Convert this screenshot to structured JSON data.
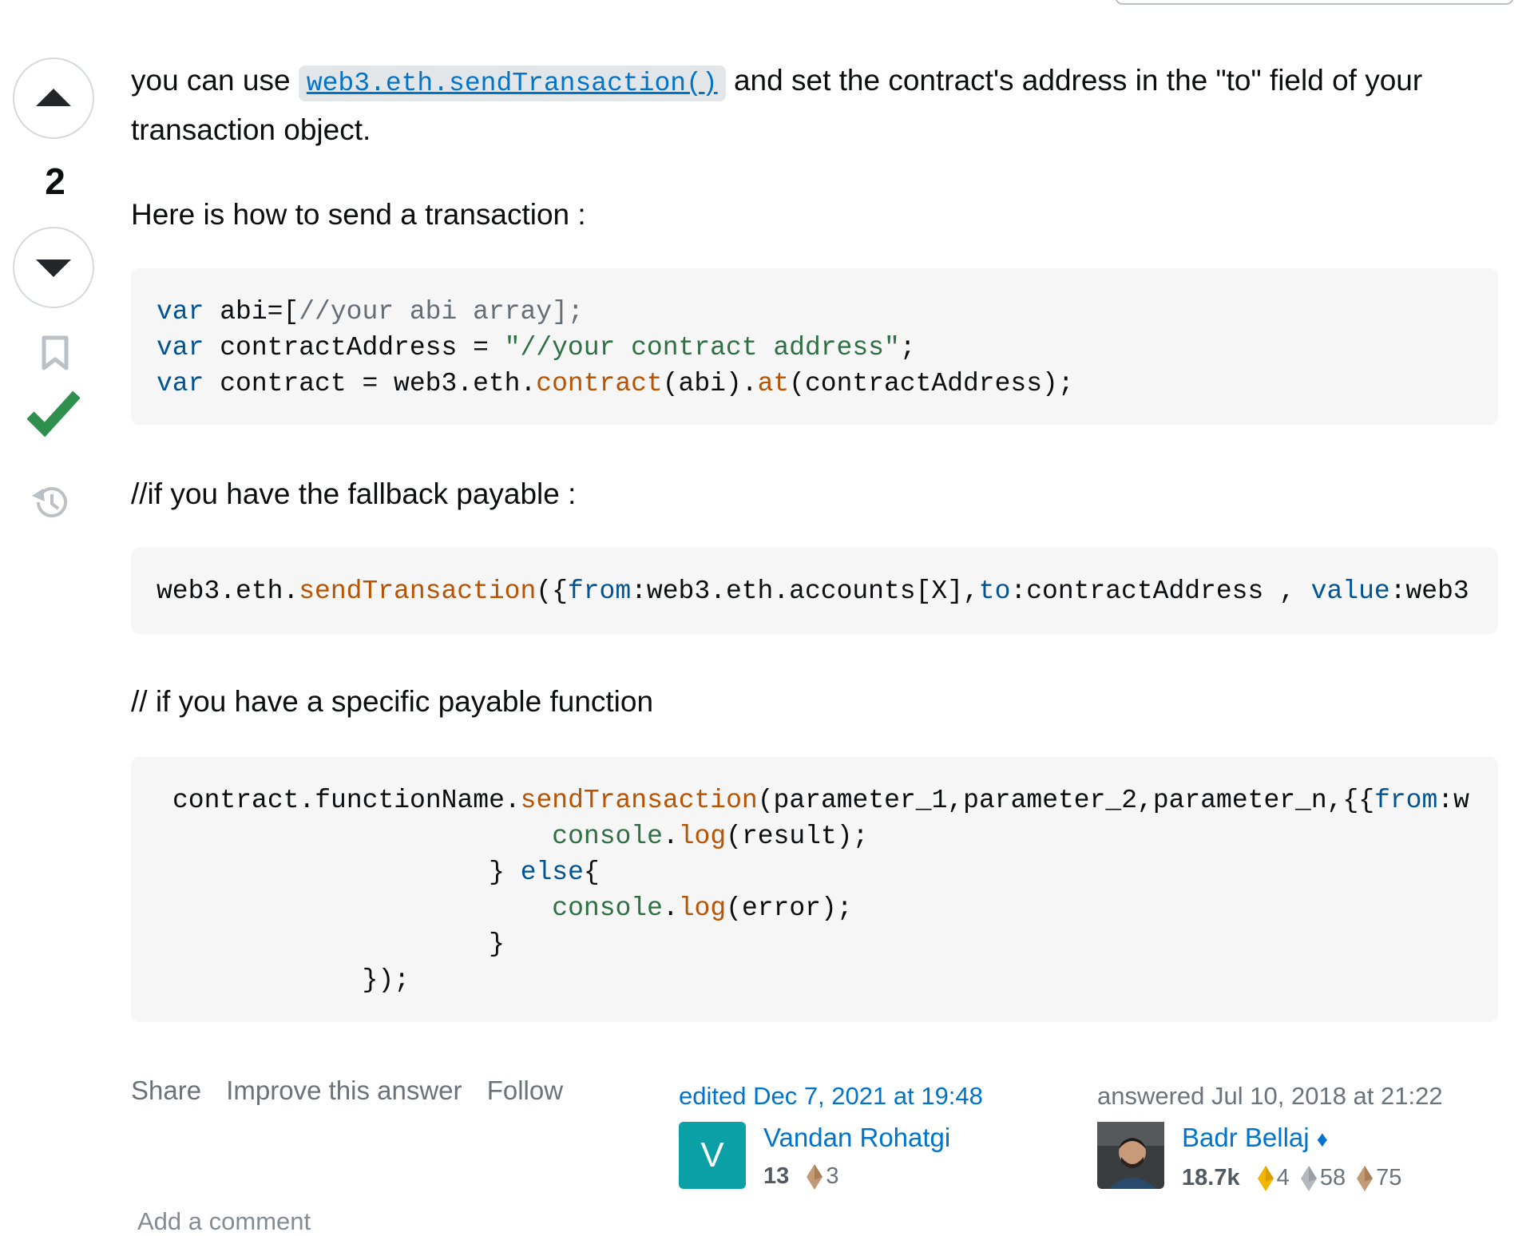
{
  "post": {
    "intro_prefix": "you can use ",
    "intro_code": "web3.eth.sendTransaction()",
    "intro_suffix": " and set the contract's address in the \"to\" field of your transaction object.",
    "how_to": "Here is how to send a transaction :",
    "fallback_note": "//if you have the fallback payable :",
    "specific_note": "// if you have a specific payable function"
  },
  "votes": {
    "count": "2"
  },
  "code1": {
    "l1_kw": "var",
    "l1_a": " abi=[",
    "l1_cm": "//your abi array];",
    "l2_kw": "var",
    "l2_a": " contractAddress = ",
    "l2_str": "\"//your contract address\"",
    "l2_b": ";",
    "l3_kw": "var",
    "l3_a": " contract = web3.eth.",
    "l3_fn1": "contract",
    "l3_b": "(abi).",
    "l3_fn2": "at",
    "l3_c": "(contractAddress);"
  },
  "code2": {
    "a": "web3.eth.",
    "fn": "sendTransaction",
    "b": "({",
    "kw1": "from",
    "c": ":web3.eth.accounts[X],",
    "kw2": "to",
    "d": ":contractAddress , ",
    "kw3": "value",
    "e": ":web3"
  },
  "code3": {
    "l1_a": "contract.functionName.",
    "l1_fn": "sendTransaction",
    "l1_b": "(parameter_1,parameter_2,parameter_n,{{",
    "l1_kw": "from",
    "l1_c": ":w",
    "l2_indent": "                        ",
    "l2_obj": "console",
    "l2_dot": ".",
    "l2_fn": "log",
    "l2_b": "(result);",
    "l3_indent": "                    ",
    "l3_a": "} ",
    "l3_kw": "else",
    "l3_b": "{",
    "l4_indent": "                        ",
    "l4_obj": "console",
    "l4_dot": ".",
    "l4_fn": "log",
    "l4_b": "(error);",
    "l5_indent": "                    ",
    "l5_a": "}",
    "l6_indent": "            ",
    "l6_a": "});"
  },
  "menu": {
    "share": "Share",
    "improve": "Improve this answer",
    "follow": "Follow"
  },
  "editor": {
    "action": "edited Dec 7, 2021 at 19:48",
    "initial": "V",
    "name": "Vandan Rohatgi",
    "rep": "13",
    "bronze": "3",
    "avatar_color": "#0b9fa6"
  },
  "owner": {
    "action": "answered Jul 10, 2018 at 21:22",
    "name": "Badr Bellaj",
    "diamond": "♦",
    "rep": "18.7k",
    "gold": "4",
    "silver": "58",
    "bronze": "75"
  },
  "comments": {
    "add_label": "Add a comment"
  },
  "colors": {
    "link": "#0074cc",
    "accepted": "#2f8f4e",
    "code_bg": "#f6f6f6"
  }
}
